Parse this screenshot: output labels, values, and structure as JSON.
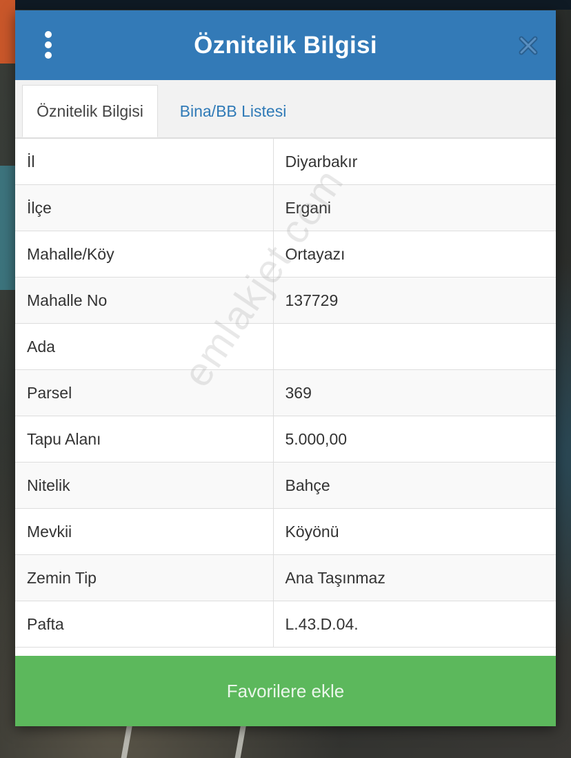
{
  "dialog": {
    "title": "Öznitelik Bilgisi",
    "icons": {
      "menu": "more-vertical-icon",
      "close": "close-icon"
    }
  },
  "tabs": [
    {
      "label": "Öznitelik Bilgisi",
      "active": true
    },
    {
      "label": "Bina/BB Listesi",
      "active": false
    }
  ],
  "rows": [
    {
      "key": "İl",
      "value": "Diyarbakır"
    },
    {
      "key": "İlçe",
      "value": "Ergani"
    },
    {
      "key": "Mahalle/Köy",
      "value": "Ortayazı"
    },
    {
      "key": "Mahalle No",
      "value": "137729"
    },
    {
      "key": "Ada",
      "value": ""
    },
    {
      "key": "Parsel",
      "value": "369"
    },
    {
      "key": "Tapu Alanı",
      "value": "5.000,00"
    },
    {
      "key": "Nitelik",
      "value": "Bahçe"
    },
    {
      "key": "Mevkii",
      "value": "Köyönü"
    },
    {
      "key": "Zemin Tip",
      "value": "Ana Taşınmaz"
    },
    {
      "key": "Pafta",
      "value": "L.43.D.04."
    }
  ],
  "favorite_button": "Favorilere ekle",
  "watermark": "emlakjet.com",
  "colors": {
    "header": "#337ab7",
    "tab_link": "#2f7ab7",
    "favorite_button": "#5cb85c"
  }
}
